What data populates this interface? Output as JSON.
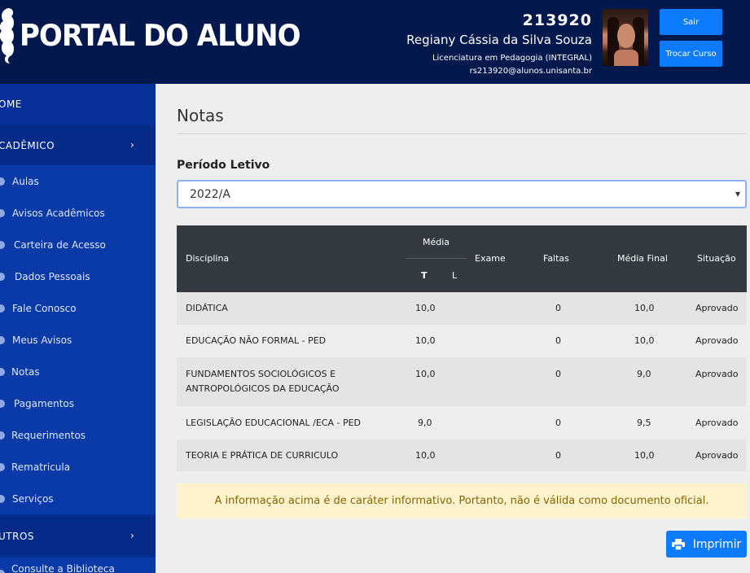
{
  "header": {
    "logo_text": "PORTAL DO ALUNO",
    "user_id": "213920",
    "user_name": "Regiany Cássia da Silva Souza",
    "course": "Licenciatura em Pedagogia (INTEGRAL)",
    "email": "rs213920@alunos.unisanta.br",
    "sair_label": "Sair",
    "trocar_label": "Trocar Curso"
  },
  "sidebar": {
    "home": "OME",
    "academico": "CADÊMICO",
    "items": [
      {
        "label": "Aulas",
        "icon": "circle-icon"
      },
      {
        "label": "Avisos Acadêmicos",
        "icon": "bell-icon"
      },
      {
        "label": "Carteira de Acesso",
        "icon": "card-icon"
      },
      {
        "label": "Dados Pessoais",
        "icon": "user-icon"
      },
      {
        "label": "Fale Conosco",
        "icon": "chat-icon"
      },
      {
        "label": "Meus Avisos",
        "icon": "bell-icon"
      },
      {
        "label": "Notas",
        "icon": "file-icon"
      },
      {
        "label": "Pagamentos",
        "icon": "money-icon"
      },
      {
        "label": "Requerimentos",
        "icon": "file-icon"
      },
      {
        "label": "Rematricula",
        "icon": "refresh-icon"
      },
      {
        "label": "Serviços",
        "icon": "gear-icon"
      }
    ],
    "outros": "UTROS",
    "biblioteca": "Consulte a Biblioteca"
  },
  "main": {
    "title": "Notas",
    "periodo_label": "Período Letivo",
    "periodo_value": "2022/A",
    "table": {
      "headers": {
        "disciplina": "Disciplina",
        "media": "Média",
        "t": "T",
        "l": "L",
        "exame": "Exame",
        "faltas": "Faltas",
        "media_final": "Média Final",
        "situacao": "Situação"
      },
      "rows": [
        {
          "disciplina": "DIDÁTICA",
          "t": "10,0",
          "l": "",
          "exame": "",
          "faltas": "0",
          "media_final": "10,0",
          "situacao": "Aprovado"
        },
        {
          "disciplina": "EDUCAÇÃO NÃO FORMAL - PED",
          "t": "10,0",
          "l": "",
          "exame": "",
          "faltas": "0",
          "media_final": "10,0",
          "situacao": "Aprovado"
        },
        {
          "disciplina": "FUNDAMENTOS SOCIOLÓGICOS E",
          "disciplina2": "ANTROPOLÓGICOS DA EDUCAÇÃO",
          "t": "10,0",
          "l": "",
          "exame": "",
          "faltas": "0",
          "media_final": "9,0",
          "situacao": "Aprovado"
        },
        {
          "disciplina": "LEGISLAÇÃO EDUCACIONAL /ECA - PED",
          "t": "9,0",
          "l": "",
          "exame": "",
          "faltas": "0",
          "media_final": "9,5",
          "situacao": "Aprovado"
        },
        {
          "disciplina": "TEORIA E PRÁTICA DE CURRICULO",
          "t": "10,0",
          "l": "",
          "exame": "",
          "faltas": "0",
          "media_final": "10,0",
          "situacao": "Aprovado"
        }
      ]
    },
    "notice": "A informação acima é de caráter informativo. Portanto, não é válida como documento oficial.",
    "print_label": "Imprimir"
  },
  "colors": {
    "header_bg": "#03184d",
    "sidebar_bg": "#072f99",
    "primary_button": "#0d7bff",
    "table_header": "#343a40",
    "notice_bg": "#fff3cd"
  }
}
